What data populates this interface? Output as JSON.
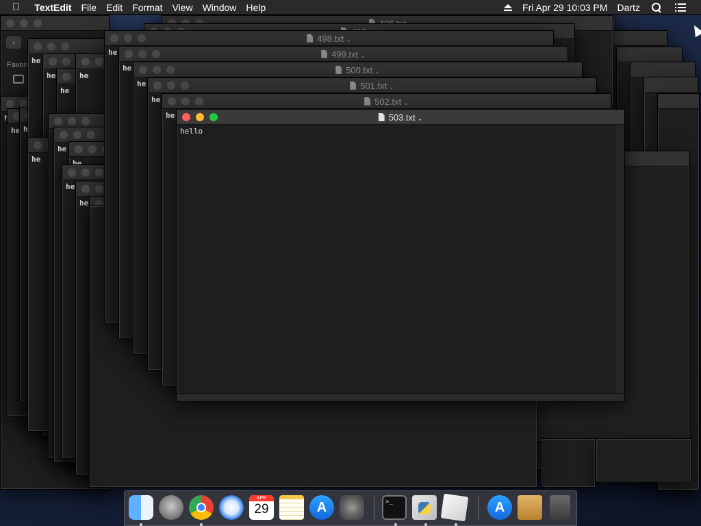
{
  "menubar": {
    "app_name": "TextEdit",
    "items": [
      "File",
      "Edit",
      "Format",
      "View",
      "Window",
      "Help"
    ],
    "datetime": "Fri Apr 29  10:03 PM",
    "user": "Dartz"
  },
  "finder": {
    "sidebar_label": "Favori"
  },
  "windows": {
    "w496": {
      "title": "496.txt"
    },
    "w497": {
      "title": "497.txt"
    },
    "w498": {
      "title": "498.txt"
    },
    "w499": {
      "title": "499.txt"
    },
    "w500": {
      "title": "500.txt"
    },
    "w501": {
      "title": "501.txt"
    },
    "w502": {
      "title": "502.txt"
    },
    "w503": {
      "title": "503.txt",
      "content": "hello"
    }
  },
  "bg_text": {
    "fragment": "he"
  },
  "dock": {
    "calendar_month": "APR",
    "calendar_day": "29",
    "terminal_prompt": ">_"
  },
  "colors": {
    "close": "#ff5f57",
    "minimize": "#febc2e",
    "zoom": "#28c840",
    "window_bg": "#1e1e1e",
    "titlebar": "#3a3a3a"
  }
}
